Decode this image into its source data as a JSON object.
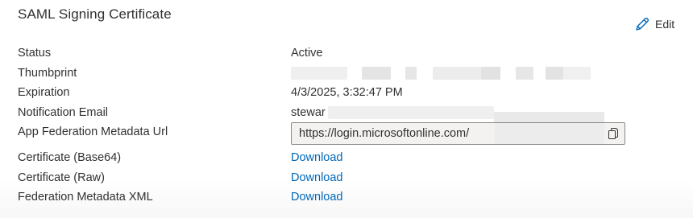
{
  "section": {
    "title": "SAML Signing Certificate",
    "edit_label": "Edit"
  },
  "fields": {
    "status": {
      "label": "Status",
      "value": "Active"
    },
    "thumbprint": {
      "label": "Thumbprint",
      "value": ""
    },
    "expiration": {
      "label": "Expiration",
      "value": "4/3/2025, 3:32:47 PM"
    },
    "notification_email": {
      "label": "Notification Email",
      "value": "stewar"
    },
    "metadata_url": {
      "label": "App Federation Metadata Url",
      "value": "https://login.microsoftonline.com/"
    },
    "cert_base64": {
      "label": "Certificate (Base64)",
      "link": "Download"
    },
    "cert_raw": {
      "label": "Certificate (Raw)",
      "link": "Download"
    },
    "federation_xml": {
      "label": "Federation Metadata XML",
      "link": "Download"
    }
  },
  "icons": {
    "edit": "pencil-icon",
    "copy": "copy-icon"
  },
  "colors": {
    "link": "#0067b8",
    "accent_icon": "#0067b8",
    "text": "#323130"
  }
}
